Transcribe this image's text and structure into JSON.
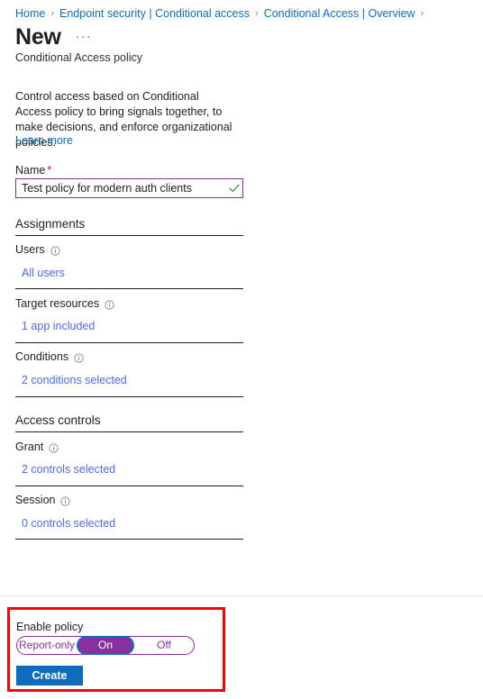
{
  "breadcrumb": {
    "separator": "›",
    "items": [
      {
        "label": "Home"
      },
      {
        "label": "Endpoint security | Conditional access"
      },
      {
        "label": "Conditional Access | Overview"
      }
    ]
  },
  "header": {
    "title": "New",
    "more_actions": "···",
    "subtitle": "Conditional Access policy"
  },
  "intro": {
    "description": "Control access based on Conditional Access policy to bring signals together, to make decisions, and enforce organizational policies.",
    "learn_more": "Learn more"
  },
  "name_field": {
    "label": "Name",
    "required_marker": "*",
    "value": "Test policy for modern auth clients",
    "placeholder": "",
    "valid_icon": "checkmark-icon"
  },
  "sections": [
    {
      "heading": "Assignments",
      "fields": [
        {
          "label": "Users",
          "value": "All users",
          "info_icon": "info-icon"
        },
        {
          "label": "Target resources",
          "value": "1 app included",
          "info_icon": "info-icon"
        },
        {
          "label": "Conditions",
          "value": "2 conditions selected",
          "info_icon": "info-icon"
        }
      ]
    },
    {
      "heading": "Access controls",
      "fields": [
        {
          "label": "Grant",
          "value": "2 controls selected",
          "info_icon": "info-icon"
        },
        {
          "label": "Session",
          "value": "0 controls selected",
          "info_icon": "info-icon"
        }
      ]
    }
  ],
  "footer": {
    "enable_policy_label": "Enable policy",
    "toggle": {
      "options": [
        "Report-only",
        "On",
        "Off"
      ],
      "selected": "On"
    },
    "create_label": "Create"
  },
  "colors": {
    "link_blue": "#0f6cbd",
    "value_blue": "#4f6bed",
    "accent_purple": "#8a2f9e",
    "primary_button": "#0f6cbd",
    "highlight_red": "#ff0000",
    "required_red": "#a4262c",
    "valid_green": "#107c10"
  }
}
